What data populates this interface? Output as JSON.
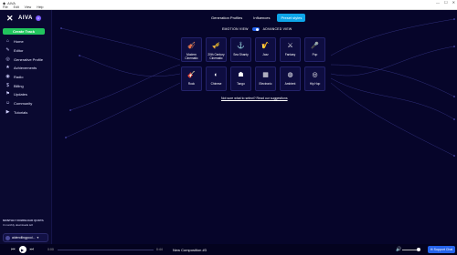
{
  "window": {
    "title": "AIVA",
    "controls": [
      "—",
      "☐",
      "✕"
    ]
  },
  "menubar": [
    "File",
    "Edit",
    "View",
    "Help"
  ],
  "sidebar": {
    "brand": "AIVA",
    "badge": "β",
    "create_label": "Create Track",
    "items": [
      {
        "label": "Home",
        "icon": "⌂"
      },
      {
        "label": "Editor",
        "icon": "✎"
      },
      {
        "label": "Generative Profile",
        "icon": "◎"
      },
      {
        "label": "Achievements",
        "icon": "★"
      },
      {
        "label": "Radio",
        "icon": "◉"
      },
      {
        "label": "Billing",
        "icon": "$"
      },
      {
        "label": "Updates",
        "icon": "⚑"
      },
      {
        "label": "Community",
        "icon": "☺"
      },
      {
        "label": "Tutorials",
        "icon": "▶"
      }
    ],
    "quota_title": "MONTHLY DOWNLOAD QUOTA",
    "quota_text": "3 monthly downloads left",
    "user_email": "aiderollingpool..."
  },
  "main": {
    "tabs": [
      "Generation Profiles",
      "Influences",
      "Preset styles"
    ],
    "toggle_left": "EMOTION VIEW",
    "toggle_right": "ADVANCED VIEW",
    "styles": [
      {
        "label": "Modern Cinematic",
        "icon": "🎻"
      },
      {
        "label": "20th Century Cinematic",
        "icon": "🎺"
      },
      {
        "label": "Sea Shanty",
        "icon": "⚓"
      },
      {
        "label": "Jazz",
        "icon": "🎷"
      },
      {
        "label": "Fantasy",
        "icon": "⚔"
      },
      {
        "label": "Pop",
        "icon": "🎤"
      },
      {
        "label": "Rock",
        "icon": "🎸"
      },
      {
        "label": "Chinese",
        "icon": "◐"
      },
      {
        "label": "Tango",
        "icon": "☗"
      },
      {
        "label": "Electronic",
        "icon": "▦"
      },
      {
        "label": "Ambient",
        "icon": "◍"
      },
      {
        "label": "Hip Hop",
        "icon": "◎"
      }
    ],
    "suggest_link": "Not sure what to select? Read our suggestions"
  },
  "player": {
    "time_current": "0:00",
    "time_total": "0:44",
    "now_playing": "New Composition #3",
    "support_label": "Support Chat"
  }
}
